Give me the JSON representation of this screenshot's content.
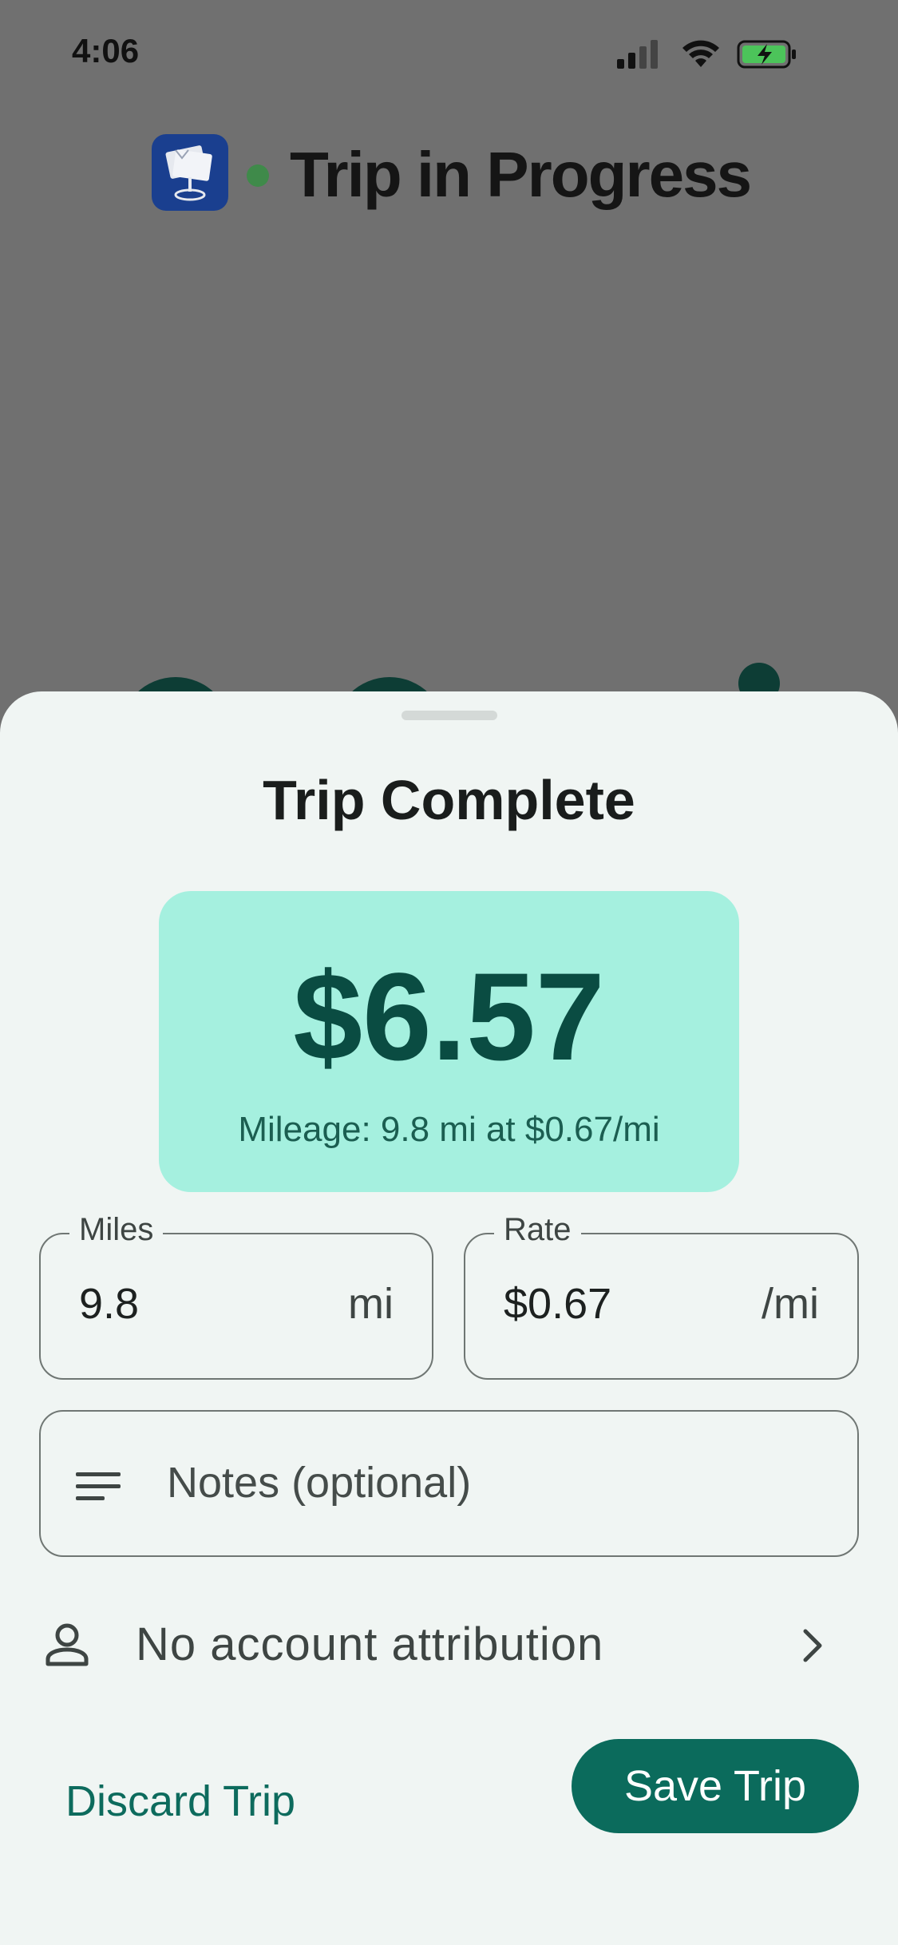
{
  "status_bar": {
    "time": "4:06",
    "icons": [
      "cellular-signal-icon",
      "wifi-icon",
      "battery-charging-icon"
    ]
  },
  "header": {
    "title": "Trip in Progress",
    "app_icon": "app-logo-icon",
    "live_indicator_color": "#3f8a4a"
  },
  "sheet": {
    "title": "Trip Complete",
    "amount": "$6.57",
    "amount_detail": "Mileage: 9.8 mi at $0.67/mi",
    "miles": {
      "label": "Miles",
      "value": "9.8",
      "suffix": "mi"
    },
    "rate": {
      "label": "Rate",
      "value": "$0.67",
      "suffix": "/mi"
    },
    "notes": {
      "placeholder": "Notes (optional)",
      "icon": "notes-lines-icon"
    },
    "account": {
      "label": "No account attribution",
      "icon": "person-icon",
      "chevron": "chevron-right-icon"
    },
    "discard_label": "Discard Trip",
    "save_label": "Save Trip"
  },
  "colors": {
    "accent": "#0b6b5c",
    "amount_card": "#a5f0df",
    "amount_text": "#0a4c42",
    "sheet_bg": "#f0f5f3",
    "scrim": "#707070"
  }
}
